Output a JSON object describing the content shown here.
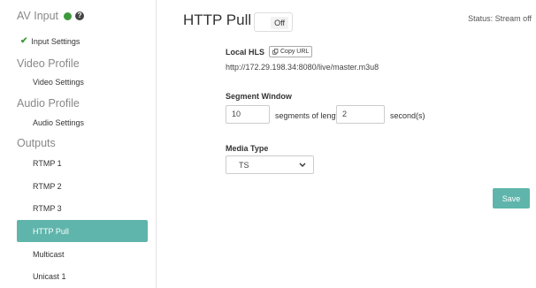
{
  "sidebar": {
    "av_input": {
      "title": "AV Input",
      "status_color": "#3c9a3c",
      "help": "?"
    },
    "input_settings": {
      "label": "Input Settings",
      "check": "✔"
    },
    "video_profile": {
      "title": "Video Profile",
      "items": [
        {
          "label": "Video Settings"
        }
      ]
    },
    "audio_profile": {
      "title": "Audio Profile",
      "items": [
        {
          "label": "Audio Settings"
        }
      ]
    },
    "outputs": {
      "title": "Outputs",
      "items": [
        {
          "label": "RTMP 1"
        },
        {
          "label": "RTMP 2"
        },
        {
          "label": "RTMP 3"
        },
        {
          "label": "HTTP Pull",
          "active": true
        },
        {
          "label": "Multicast"
        },
        {
          "label": "Unicast 1"
        }
      ]
    }
  },
  "header": {
    "title": "HTTP Pull",
    "toggle_label": "Off",
    "status": "Status: Stream off"
  },
  "local_hls": {
    "label": "Local HLS",
    "copy_button": "Copy URL",
    "url": "http://172.29.198.34:8080/live/master.m3u8"
  },
  "segment_window": {
    "label": "Segment Window",
    "segments_value": "10",
    "segments_text": "segments of length",
    "length_value": "2",
    "seconds_text": "second(s)"
  },
  "media_type": {
    "label": "Media Type",
    "selected": "TS"
  },
  "actions": {
    "save": "Save"
  },
  "colors": {
    "accent": "#5fb5ab",
    "status_green": "#3c9a3c"
  }
}
